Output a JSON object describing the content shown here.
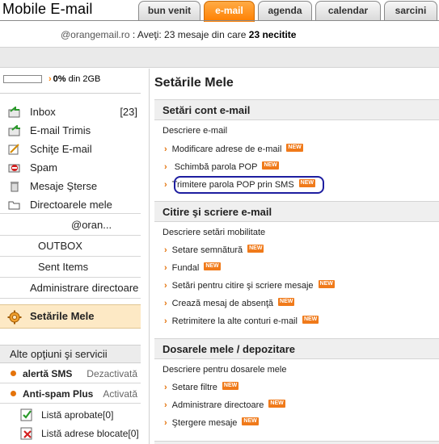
{
  "app": {
    "title": "Mobile E-mail"
  },
  "tabs": [
    {
      "label": "bun venit",
      "active": false
    },
    {
      "label": "e-mail",
      "active": true
    },
    {
      "label": "agenda",
      "active": false
    },
    {
      "label": "calendar",
      "active": false
    },
    {
      "label": "sarcini",
      "active": false
    }
  ],
  "info": {
    "email": "@orangemail.ro",
    "text": " : Aveţi: 23 mesaje din care ",
    "unread": "23 necitite"
  },
  "quota": {
    "percent_text": "0%",
    "suffix": " din 2GB",
    "used_fraction": 0
  },
  "folders": [
    {
      "label": "Inbox",
      "count": "[23]",
      "icon": "inbox-icon"
    },
    {
      "label": "E-mail Trimis",
      "count": "",
      "icon": "sent-icon"
    },
    {
      "label": "Schiţe E-mail",
      "count": "",
      "icon": "drafts-icon"
    },
    {
      "label": "Spam",
      "count": "",
      "icon": "spam-icon"
    },
    {
      "label": "Mesaje Şterse",
      "count": "",
      "icon": "trash-icon"
    },
    {
      "label": "Directoarele mele",
      "count": "",
      "icon": "folder-icon"
    }
  ],
  "subfolders": {
    "account": "@oran...",
    "outbox": "OUTBOX",
    "sent_items": "Sent Items",
    "manage": "Administrare directoare"
  },
  "settings_item": {
    "label": "Setările Mele",
    "icon": "settings-icon"
  },
  "other_services": {
    "heading": "Alte opţiuni şi servicii",
    "services": [
      {
        "name": "alertă SMS",
        "state": "Dezactivată"
      },
      {
        "name": "Anti-spam Plus",
        "state": "Activată"
      }
    ],
    "lists": [
      {
        "label": "Listă aprobate[0]",
        "icon": "approved-list-icon"
      },
      {
        "label": "Listă adrese blocate[0]",
        "icon": "blocked-list-icon"
      }
    ]
  },
  "main": {
    "title": "Setările Mele",
    "sections": [
      {
        "heading": "Setări cont e-mail",
        "description": "Descriere e-mail",
        "links": [
          {
            "label": "Modificare adrese de e-mail",
            "badge": "NEW"
          },
          {
            "label": "Schimbă parola POP",
            "badge": "NEW"
          },
          {
            "label": "Trimitere parola POP prin SMS",
            "badge": "NEW"
          }
        ]
      },
      {
        "heading": "Citire şi scriere e-mail",
        "description": "Descriere setări mobilitate",
        "links": [
          {
            "label": "Setare semnătură",
            "badge": "NEW"
          },
          {
            "label": "Fundal",
            "badge": "NEW"
          },
          {
            "label": "Setări pentru citire şi scriere mesaje",
            "badge": "NEW"
          },
          {
            "label": "Crează mesaj de absenţă",
            "badge": "NEW"
          },
          {
            "label": "Retrimitere la alte conturi e-mail",
            "badge": "NEW"
          }
        ]
      },
      {
        "heading": "Dosarele mele / depozitare",
        "description": "Descriere pentru dosarele mele",
        "links": [
          {
            "label": "Setare filtre",
            "badge": "NEW"
          },
          {
            "label": "Administrare directoare",
            "badge": "NEW"
          },
          {
            "label": "Ştergere mesaje",
            "badge": "NEW"
          }
        ]
      }
    ]
  },
  "colors": {
    "accent": "#ff7f00",
    "highlight_border": "#1e1ea0",
    "badge": "#f07a1a"
  }
}
